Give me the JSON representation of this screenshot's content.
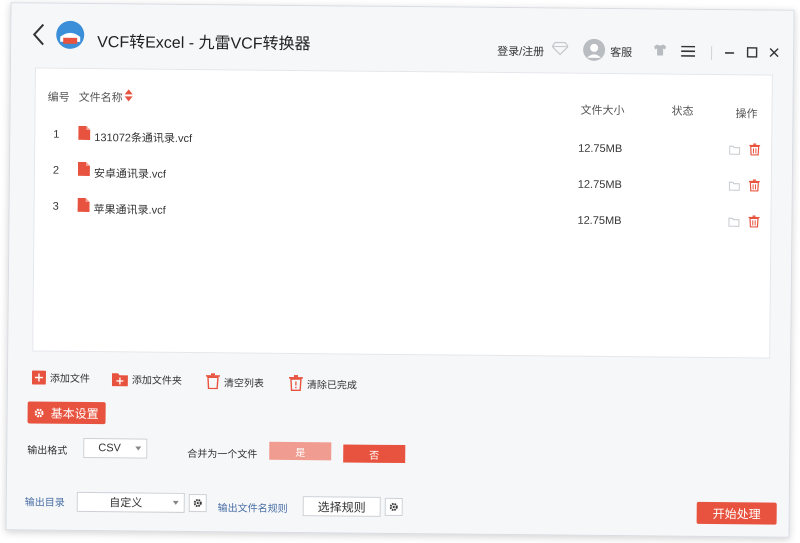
{
  "titlebar": {
    "title": "VCF转Excel - 九雷VCF转换器",
    "login_label": "登录/注册",
    "service_label": "客服"
  },
  "table": {
    "headers": {
      "num": "编号",
      "name": "文件名称",
      "size": "文件大小",
      "status": "状态",
      "action": "操作"
    },
    "rows": [
      {
        "num": "1",
        "name": "131072条通讯录.vcf",
        "size": "12.75MB",
        "status": ""
      },
      {
        "num": "2",
        "name": "安卓通讯录.vcf",
        "size": "12.75MB",
        "status": ""
      },
      {
        "num": "3",
        "name": "苹果通讯录.vcf",
        "size": "12.75MB",
        "status": ""
      }
    ]
  },
  "toolbar": {
    "add_file": "添加文件",
    "add_folder": "添加文件夹",
    "clear_list": "清空列表",
    "clear_done": "清除已完成"
  },
  "settings": {
    "basic_label": "基本设置",
    "output_format_label": "输出格式",
    "output_format_value": "CSV",
    "merge_label": "合并为一个文件",
    "yes_label": "是",
    "no_label": "否",
    "output_dir_label": "输出目录",
    "output_dir_value": "自定义",
    "filename_rule_label": "输出文件名规则",
    "choose_rule_label": "选择规则",
    "start_label": "开始处理"
  },
  "colors": {
    "accent": "#e8533f",
    "accent_light": "#f19c90",
    "link_blue": "#4a6fa5"
  }
}
